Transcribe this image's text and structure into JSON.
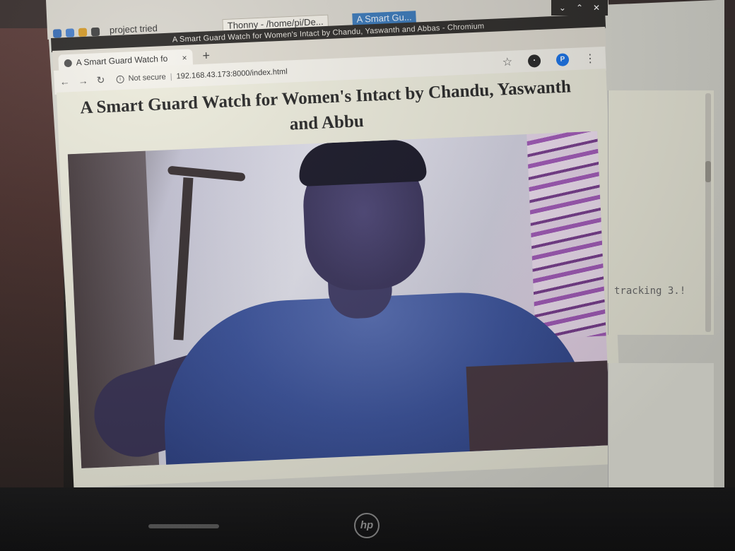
{
  "taskbar": {
    "folder_item": "project tried",
    "thonny_item": "Thonny  -  /home/pi/De...",
    "chrome_item": "A Smart Gu..."
  },
  "window": {
    "title": "A Smart Guard Watch for Women's Intact by Chandu, Yaswanth and Abbas - Chromium"
  },
  "tab": {
    "label": "A Smart Guard Watch fo",
    "close": "×",
    "new_tab": "+"
  },
  "toolbar": {
    "security_label": "Not secure",
    "separator": "|",
    "url": "192.168.43.173:8000/index.html",
    "profile_initial": "P"
  },
  "page": {
    "title": "A Smart Guard Watch for Women's Intact by Chandu, Yaswanth and Abbu"
  },
  "thonny": {
    "shell_text": "tracking 3.!"
  },
  "device": {
    "brand": "hp"
  }
}
